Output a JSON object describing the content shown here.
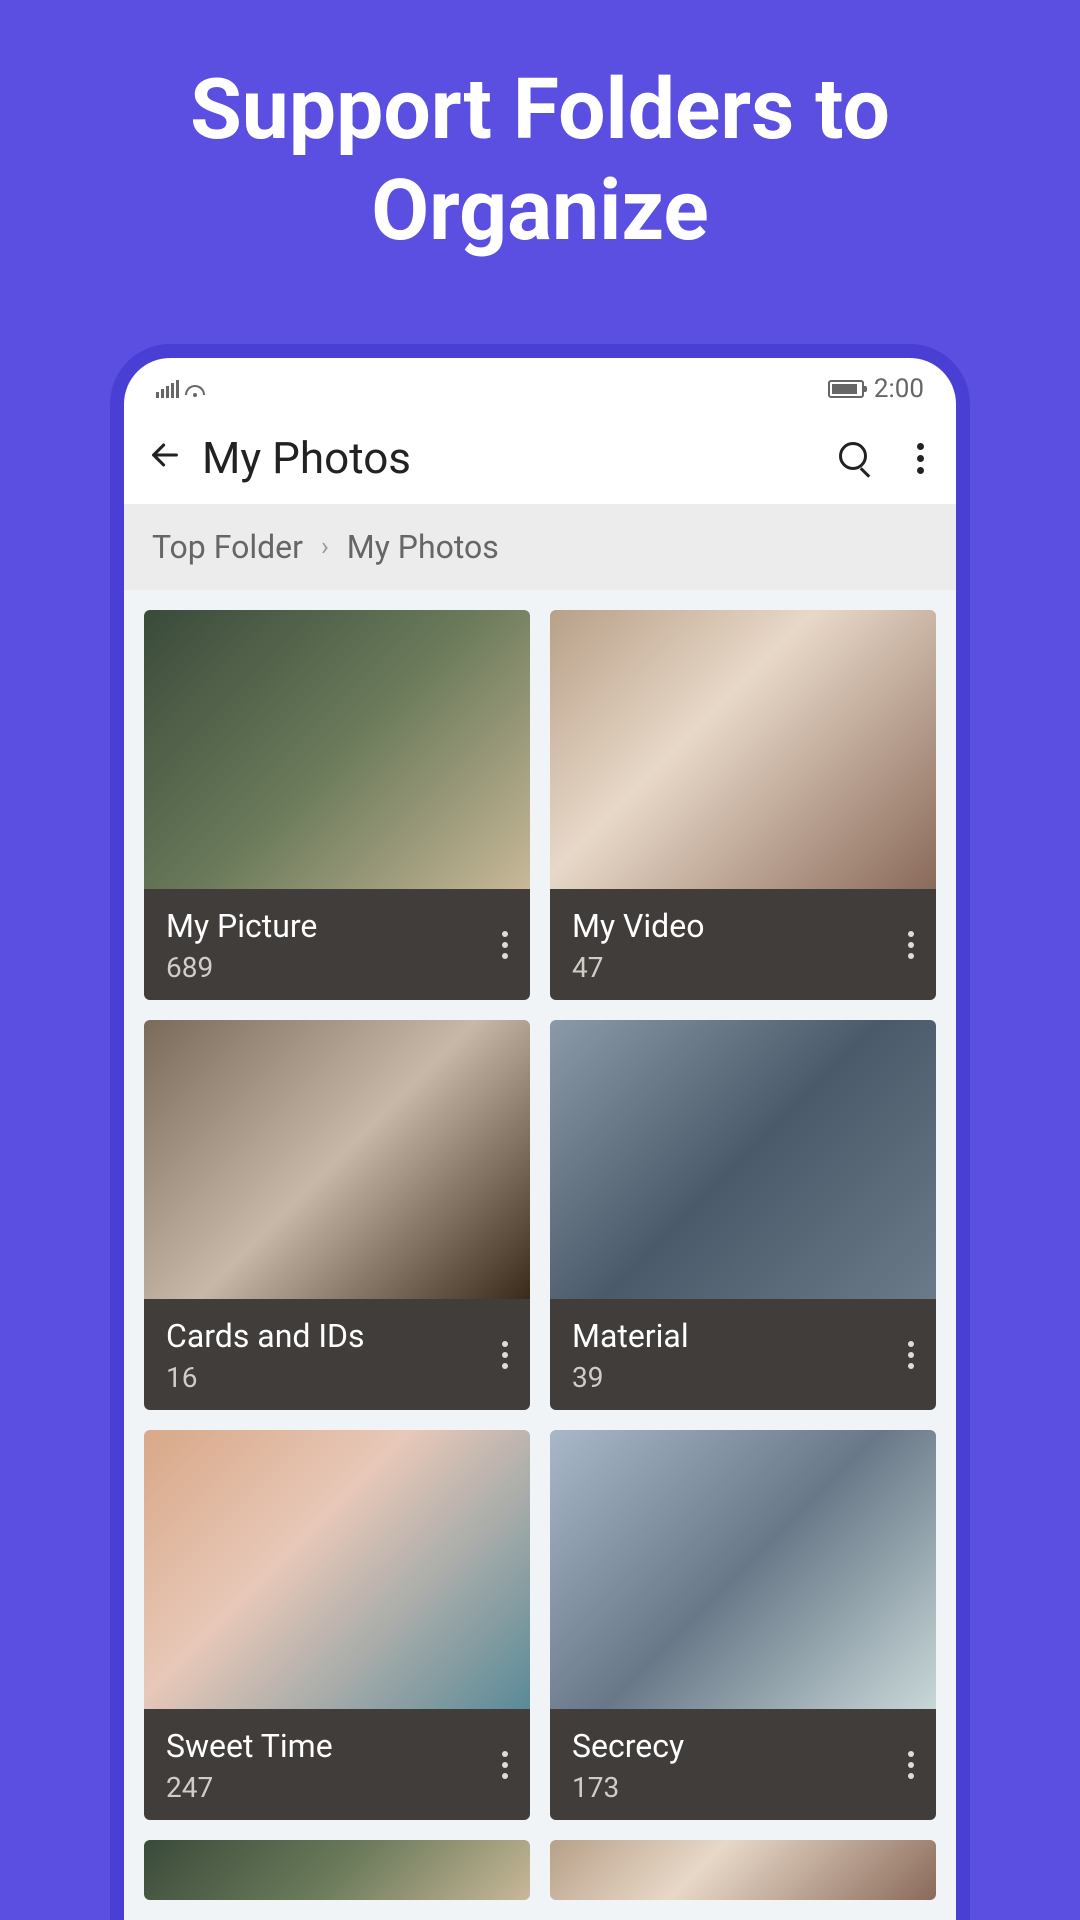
{
  "promo": {
    "title": "Support Folders to Organize"
  },
  "statusBar": {
    "time": "2:00"
  },
  "appBar": {
    "title": "My Photos"
  },
  "breadcrumb": {
    "parent": "Top Folder",
    "current": "My Photos"
  },
  "folders": [
    {
      "name": "My Picture",
      "count": "689"
    },
    {
      "name": "My Video",
      "count": "47"
    },
    {
      "name": "Cards and IDs",
      "count": "16"
    },
    {
      "name": "Material",
      "count": "39"
    },
    {
      "name": "Sweet Time",
      "count": "247"
    },
    {
      "name": "Secrecy",
      "count": "173"
    }
  ]
}
